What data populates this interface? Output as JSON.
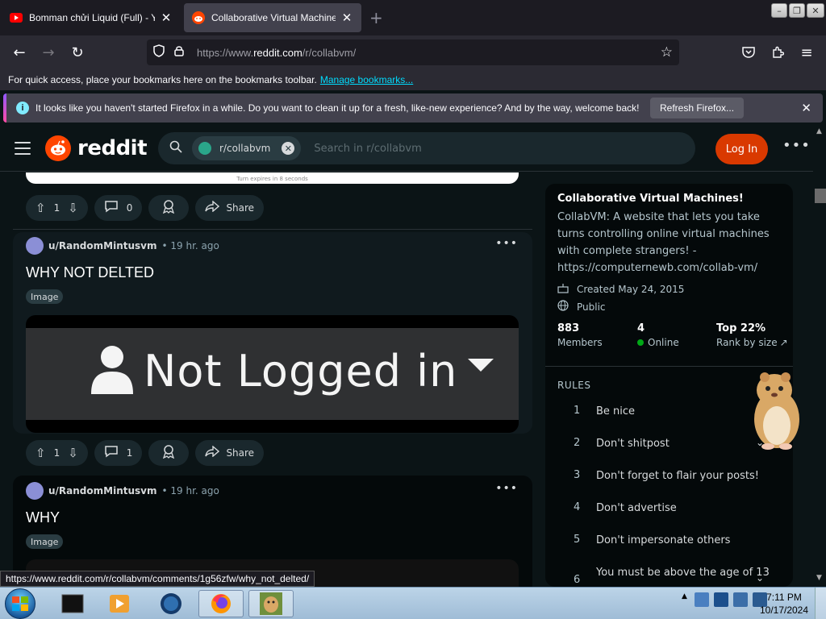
{
  "browser": {
    "tabs": [
      {
        "title": "Bomman chửi Liquid (Full) - YouTube",
        "active": false
      },
      {
        "title": "Collaborative Virtual Machines!",
        "active": true
      }
    ],
    "url_prefix": "https://www.",
    "url_domain": "reddit.com",
    "url_path": "/r/collabvm/",
    "bookmarks_text": "For quick access, place your bookmarks here on the bookmarks toolbar.",
    "bookmarks_link": "Manage bookmarks...",
    "notification": "It looks like you haven't started Firefox in a while. Do you want to clean it up for a fresh, like-new experience? And by the way, welcome back!",
    "refresh_button": "Refresh Firefox...",
    "status_url": "https://www.reddit.com/r/collabvm/comments/1g56zfw/why_not_delted/"
  },
  "reddit": {
    "logo_text": "reddit",
    "search_chip": "r/collabvm",
    "search_placeholder": "Search in r/collabvm",
    "login_label": "Log In",
    "top_image_caption": "Turn expires in 8 seconds",
    "top_actions": {
      "votes": "1",
      "comments": "0",
      "share": "Share"
    },
    "posts": [
      {
        "user": "u/RandomMintusvm",
        "time": "• 19 hr. ago",
        "title": "WHY NOT DELTED",
        "tag": "Image",
        "image_text": "Not Logged in",
        "votes": "1",
        "comments": "1",
        "share": "Share"
      },
      {
        "user": "u/RandomMintusvm",
        "time": "• 19 hr. ago",
        "title": "WHY",
        "tag": "Image"
      }
    ],
    "sidebar": {
      "title": "Collaborative Virtual Machines!",
      "description": "CollabVM: A website that lets you take turns controlling online virtual machines with complete strangers! - https://computernewb.com/collab-vm/",
      "created": "Created May 24, 2015",
      "visibility": "Public",
      "members_count": "883",
      "members_label": "Members",
      "online_count": "4",
      "online_label": "Online",
      "rank": "Top 22%",
      "rank_label": "Rank by size",
      "rules_heading": "RULES",
      "rules": [
        {
          "num": "1",
          "text": "Be nice"
        },
        {
          "num": "2",
          "text": "Don't shitpost"
        },
        {
          "num": "3",
          "text": "Don't forget to flair your posts!"
        },
        {
          "num": "4",
          "text": "Don't advertise"
        },
        {
          "num": "5",
          "text": "Don't impersonate others"
        },
        {
          "num": "6",
          "text": "You must be above the age of 13"
        }
      ]
    }
  },
  "taskbar": {
    "time": "7:11 PM",
    "date": "10/17/2024"
  },
  "colors": {
    "reddit_orange": "#ff4500",
    "login_button": "#d93900",
    "online_dot": "#01a816",
    "link": "#00ddff"
  }
}
